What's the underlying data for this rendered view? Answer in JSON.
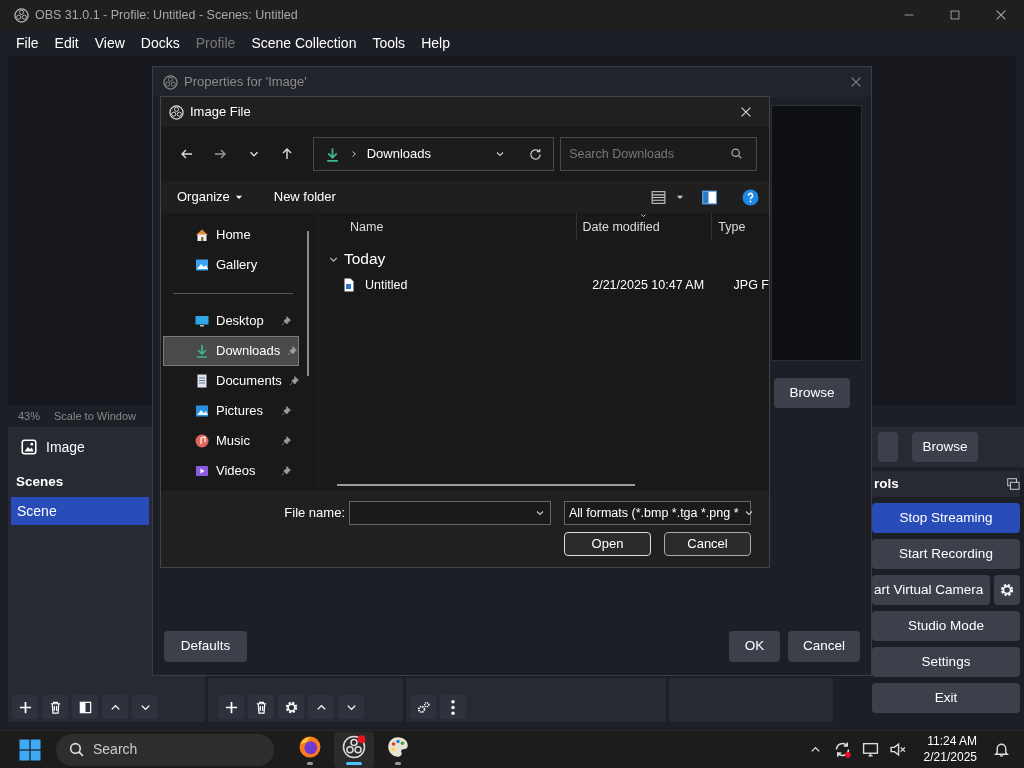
{
  "obs_window": {
    "title": "OBS 31.0.1 - Profile: Untitled - Scenes: Untitled"
  },
  "menu": [
    {
      "label": "File",
      "disabled": false
    },
    {
      "label": "Edit",
      "disabled": false
    },
    {
      "label": "View",
      "disabled": false
    },
    {
      "label": "Docks",
      "disabled": false
    },
    {
      "label": "Profile",
      "disabled": true
    },
    {
      "label": "Scene Collection",
      "disabled": false
    },
    {
      "label": "Tools",
      "disabled": false
    },
    {
      "label": "Help",
      "disabled": false
    }
  ],
  "preview_status": {
    "zoom": "43%",
    "scale_mode": "Scale to Window"
  },
  "source_toolbar": {
    "source": "Image",
    "button": "Browse"
  },
  "scenes_dock": {
    "title": "Scenes",
    "scenes": [
      {
        "label": "Scene",
        "selected": true
      }
    ]
  },
  "controls_dock": {
    "title": "rols",
    "buttons": [
      {
        "label": "Stop Streaming",
        "active": true,
        "kind": "plain"
      },
      {
        "label": "Start Recording",
        "active": false,
        "kind": "plain"
      },
      {
        "label": "art Virtual Camera",
        "active": false,
        "kind": "with-settings"
      },
      {
        "label": "Studio Mode",
        "active": false,
        "kind": "plain"
      },
      {
        "label": "Settings",
        "active": false,
        "kind": "plain"
      },
      {
        "label": "Exit",
        "active": false,
        "kind": "plain"
      }
    ]
  },
  "properties_dialog": {
    "title": "Properties for 'Image'",
    "browse": "Browse",
    "defaults": "Defaults",
    "ok": "OK",
    "cancel": "Cancel"
  },
  "file_dialog": {
    "title": "Image File",
    "address": "Downloads",
    "search": {
      "placeholder": "Search Downloads"
    },
    "commands": [
      "Organize",
      "New folder"
    ],
    "nav_sections": [
      {
        "items": [
          {
            "label": "Home",
            "kind": "home",
            "pinned": false,
            "selected": false
          },
          {
            "label": "Gallery",
            "kind": "gallery",
            "pinned": false,
            "selected": false
          }
        ]
      },
      {
        "items": [
          {
            "label": "Desktop",
            "kind": "desktop",
            "pinned": true,
            "selected": false
          },
          {
            "label": "Downloads",
            "kind": "downloads",
            "pinned": true,
            "selected": true
          },
          {
            "label": "Documents",
            "kind": "documents",
            "pinned": true,
            "selected": false
          },
          {
            "label": "Pictures",
            "kind": "pictures",
            "pinned": true,
            "selected": false
          },
          {
            "label": "Music",
            "kind": "music",
            "pinned": true,
            "selected": false
          },
          {
            "label": "Videos",
            "kind": "videos",
            "pinned": true,
            "selected": false
          }
        ]
      }
    ],
    "columns": [
      "Name",
      "Date modified",
      "Type"
    ],
    "groups": [
      {
        "label": "Today",
        "expanded": true,
        "files": [
          {
            "name": "Untitled",
            "date": "2/21/2025 10:47 AM",
            "type": "JPG F"
          }
        ]
      }
    ],
    "file_name_label": "File name:",
    "file_type": "All formats (*.bmp *.tga *.png *",
    "open": "Open",
    "cancel": "Cancel"
  },
  "taskbar": {
    "search": "Search",
    "apps": [
      {
        "kind": "firefox",
        "active": false
      },
      {
        "kind": "obs",
        "active": true
      },
      {
        "kind": "paint",
        "active": false
      }
    ],
    "time": "11:24 AM",
    "date": "2/21/2025"
  }
}
